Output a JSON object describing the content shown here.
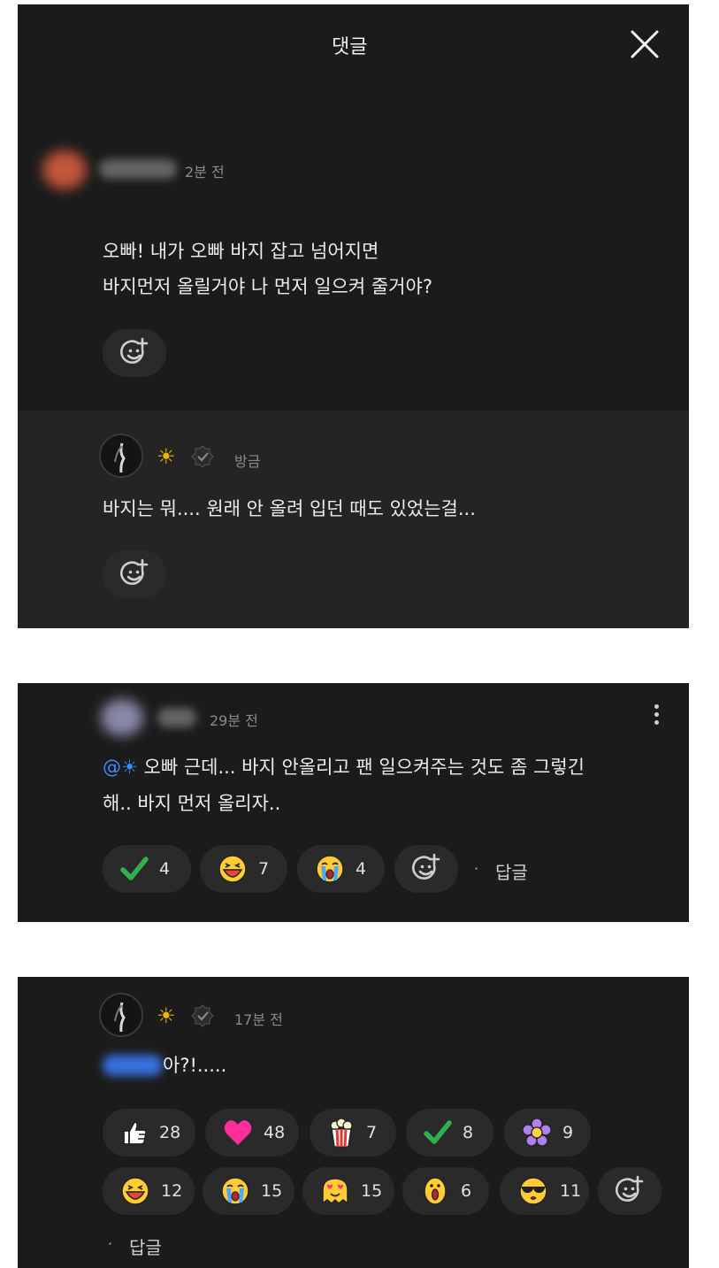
{
  "header": {
    "title": "댓글"
  },
  "comment1": {
    "time": "2분 전",
    "lines": [
      "오빠! 내가 오빠 바지 잡고 넘어지면",
      "바지먼저 올릴거야 나 먼저 일으켜 줄거야?"
    ]
  },
  "reply1": {
    "name_emoji": "☀",
    "time": "방금",
    "text": "바지는 뭐.... 원래 안 올려 입던 때도 있었는걸..."
  },
  "comment2": {
    "time": "29분 전",
    "mention": "@☀",
    "line1_rest": " 오빠 근데... 바지 안올리고 팬 일으켜주는 것도 좀 그렇긴",
    "line2": "해.. 바지 먼저 올리자..",
    "reactions": [
      {
        "icon": "check-icon",
        "count": "4"
      },
      {
        "icon": "laughing-face-icon",
        "count": "7"
      },
      {
        "icon": "crying-face-icon",
        "count": "4"
      }
    ],
    "dot": "·",
    "reply_label": "답글"
  },
  "comment3": {
    "name_emoji": "☀",
    "time": "17분 전",
    "text_rest": " 아?!.....",
    "reactions_row1": [
      {
        "icon": "thumbs-up-icon",
        "count": "28"
      },
      {
        "icon": "heart-icon",
        "count": "48"
      },
      {
        "icon": "popcorn-icon",
        "count": "7"
      },
      {
        "icon": "check-icon",
        "count": "8"
      },
      {
        "icon": "flower-icon",
        "count": "9"
      }
    ],
    "reactions_row2": [
      {
        "icon": "laughing-face-icon",
        "count": "12"
      },
      {
        "icon": "crying-face-icon",
        "count": "15"
      },
      {
        "icon": "heart-eyes-ghost-icon",
        "count": "15"
      },
      {
        "icon": "surprised-face-icon",
        "count": "6"
      },
      {
        "icon": "sunglasses-face-icon",
        "count": "11"
      }
    ],
    "dot": "·",
    "reply_label": "답글"
  },
  "colors": {
    "panel": "#1b1b1b",
    "reply_bg": "#242424",
    "pill": "#2a2a2a",
    "mention": "#3d8bff",
    "check": "#2fb24a",
    "heart": "#ff2d9b"
  }
}
